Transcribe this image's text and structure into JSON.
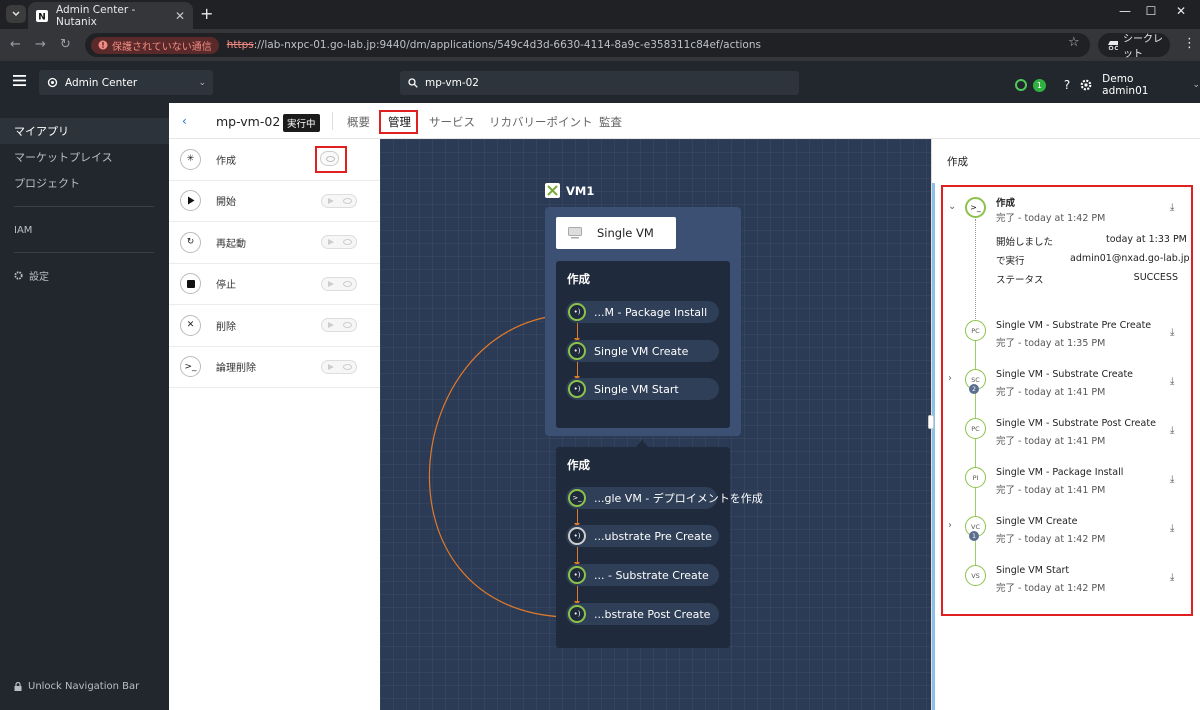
{
  "browser": {
    "tab_title": "Admin Center - Nutanix",
    "security_label": "保護されていない通信",
    "url_scheme": "https",
    "url_rest": "://lab-nxpc-01.go-lab.jp:9440/dm/applications/549c4d3d-6630-4114-8a9c-e358311c84ef/actions",
    "incognito_label": "シークレット"
  },
  "header": {
    "app_selector": "Admin Center",
    "search_value": "mp-vm-02",
    "alert_count": "1",
    "user": "Demo admin01"
  },
  "sidebar": {
    "items": [
      {
        "label": "マイアプリ",
        "active": true
      },
      {
        "label": "マーケットプレイス"
      },
      {
        "label": "プロジェクト"
      },
      {
        "label": "IAM"
      },
      {
        "label": "設定"
      }
    ],
    "unlock": "Unlock Navigation Bar"
  },
  "content": {
    "title": "mp-vm-02",
    "status_badge": "実行中",
    "tabs": [
      "概要",
      "管理",
      "サービス",
      "リカバリーポイント",
      "監査"
    ],
    "active_tab": "管理"
  },
  "actions": [
    {
      "label": "作成",
      "icon": "asterisk-icon"
    },
    {
      "label": "開始",
      "icon": "play-icon"
    },
    {
      "label": "再起動",
      "icon": "restart-icon"
    },
    {
      "label": "停止",
      "icon": "stop-icon"
    },
    {
      "label": "削除",
      "icon": "x-icon"
    },
    {
      "label": "論理削除",
      "icon": "terminal-icon"
    }
  ],
  "canvas": {
    "vm_label": "VM1",
    "service_label": "Single VM",
    "panel1": {
      "title": "作成",
      "tasks": [
        "...M - Package Install",
        "Single VM Create",
        "Single VM Start"
      ]
    },
    "panel2": {
      "title": "作成",
      "tasks": [
        "...gle VM - デプロイメントを作成",
        "...ubstrate Pre Create",
        "... - Substrate Create",
        "...bstrate Post Create"
      ]
    }
  },
  "right_panel": {
    "title": "作成",
    "root": {
      "name": "作成",
      "status": "完了 - today at 1:42 PM",
      "details": [
        {
          "k": "開始しました",
          "v": "today at 1:33 PM"
        },
        {
          "k": "で実行",
          "v": "admin01@nxad.go-lab.jp"
        },
        {
          "k": "ステータス",
          "v": "SUCCESS"
        }
      ]
    },
    "items": [
      {
        "abbr": "PC",
        "name": "Single VM - Substrate Pre Create",
        "status": "完了 - today at 1:35 PM"
      },
      {
        "abbr": "SC",
        "name": "Single VM - Substrate Create",
        "status": "完了 - today at 1:41 PM",
        "badge": "2"
      },
      {
        "abbr": "PC",
        "name": "Single VM - Substrate Post Create",
        "status": "完了 - today at 1:41 PM"
      },
      {
        "abbr": "PI",
        "name": "Single VM - Package Install",
        "status": "完了 - today at 1:41 PM"
      },
      {
        "abbr": "VC",
        "name": "Single VM Create",
        "status": "完了 - today at 1:42 PM",
        "badge": "1"
      },
      {
        "abbr": "VS",
        "name": "Single VM Start",
        "status": "完了 - today at 1:42 PM"
      }
    ]
  },
  "colors": {
    "accent_green": "#8bc34a",
    "highlight_red": "#e02020",
    "canvas_bg": "#2b3a55",
    "link_blue": "#1a6bd6"
  }
}
